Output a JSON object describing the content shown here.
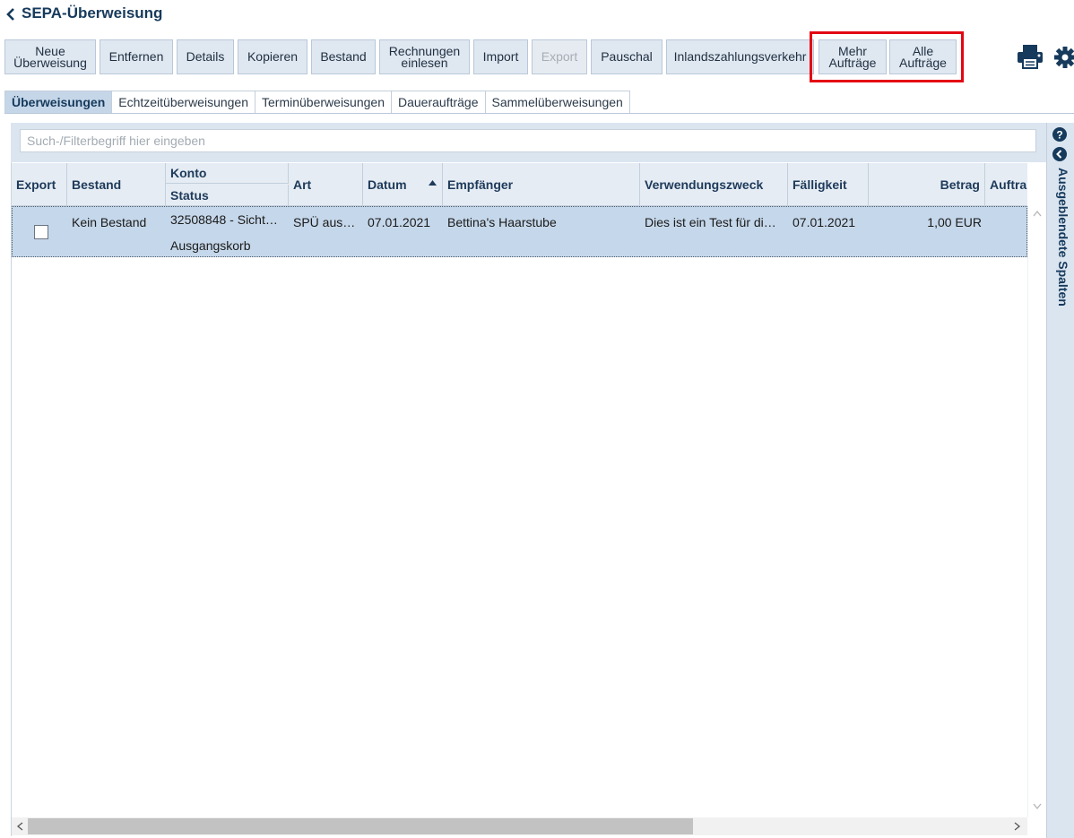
{
  "header": {
    "title": "SEPA-Überweisung"
  },
  "toolbar": {
    "buttons": [
      {
        "label": "Neue\nÜberweisung"
      },
      {
        "label": "Entfernen"
      },
      {
        "label": "Details"
      },
      {
        "label": "Kopieren"
      },
      {
        "label": "Bestand"
      },
      {
        "label": "Rechnungen\neinlesen"
      },
      {
        "label": "Import"
      },
      {
        "label": "Export",
        "disabled": true
      },
      {
        "label": "Pauschal"
      },
      {
        "label": "Inlandszahlungsverkehr"
      },
      {
        "label": "Mehr\nAufträge"
      },
      {
        "label": "Alle\nAufträge"
      }
    ],
    "highlight_color": "#e30613",
    "icons": [
      "print-icon",
      "gear-icon"
    ]
  },
  "tabs": [
    {
      "label": "Überweisungen",
      "active": true
    },
    {
      "label": "Echtzeitüberweisungen"
    },
    {
      "label": "Terminüberweisungen"
    },
    {
      "label": "Daueraufträge"
    },
    {
      "label": "Sammelüberweisungen"
    }
  ],
  "search": {
    "placeholder": "Such-/Filterbegriff hier eingeben",
    "value": ""
  },
  "table": {
    "columns": {
      "export": "Export",
      "bestand": "Bestand",
      "konto": "Konto",
      "status": "Status",
      "art": "Art",
      "datum": "Datum",
      "empfaenger": "Empfänger",
      "verwendungszweck": "Verwendungszweck",
      "faelligkeit": "Fälligkeit",
      "betrag": "Betrag",
      "auftrag": "Auftra"
    },
    "sorted_column": "Datum",
    "sort_direction": "ascending",
    "rows": [
      {
        "export_checked": false,
        "bestand": "Kein Bestand",
        "konto": "32508848 - Sicht…",
        "status": "Ausgangskorb",
        "art": "SPÜ aus…",
        "datum": "07.01.2021",
        "empfaenger": "Bettina's Haarstube",
        "verwendungszweck": "Dies ist ein Test für di…",
        "faelligkeit": "07.01.2021",
        "betrag": "1,00 EUR",
        "selected": true
      }
    ]
  },
  "side_panel": {
    "label": "Ausgeblendete Spalten",
    "icons": [
      "help-icon",
      "collapse-icon"
    ]
  },
  "colors": {
    "accent": "#163a5c",
    "button_bg": "#dfe7f1",
    "selected_row": "#c5d7ea",
    "tab_active": "#c5d6e8"
  }
}
